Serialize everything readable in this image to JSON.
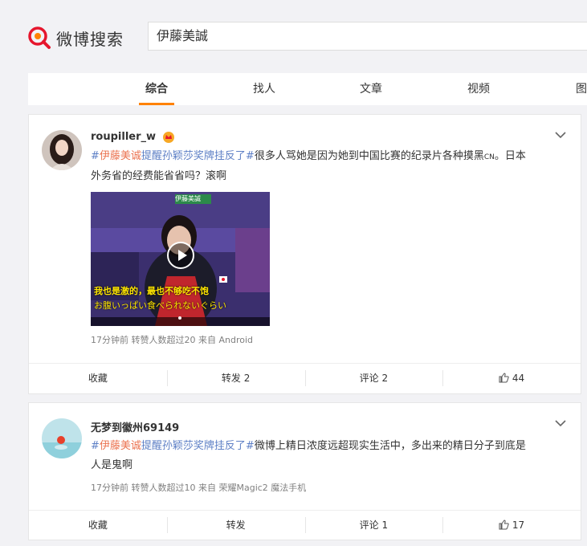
{
  "logo": {
    "text": "微博搜索"
  },
  "search": {
    "value": "伊藤美誠"
  },
  "tabs": [
    "综合",
    "找人",
    "文章",
    "视频",
    "图"
  ],
  "posts": [
    {
      "user": "roupiller_w",
      "hashtag": "#伊藤美诚提醒孙颖莎奖牌挂反了#",
      "hashtag_highlight": "伊藤美诚",
      "hashtag_rest": "提醒孙颖莎奖牌挂反了#",
      "text_line1": "很多人骂她是因为她到中国比赛的纪录片各种摸黑",
      "cn_tag": "CN",
      "text_line1_end": "。日本",
      "text_line2": "外务省的经费能省省吗？滚啊",
      "video_caption1": "我也是激的，最也不够吃不饱",
      "video_caption2": "お腹いっぱい食べられないぐらい",
      "video_tag": "伊藤美誠",
      "meta": "17分钟前  转赞人数超过20  来自 Android",
      "actions": {
        "fav": "收藏",
        "repost": "转发 2",
        "comment": "评论 2",
        "like": "44"
      }
    },
    {
      "user": "无梦到徽州69149",
      "hashtag_highlight": "伊藤美诚",
      "hashtag_rest": "提醒孙颖莎奖牌挂反了#",
      "text_line1": "微博上精日浓度远超现实生活中，多出来的精日分子到底是",
      "text_line2": "人是鬼啊",
      "meta": "17分钟前  转赞人数超过10  来自 荣耀Magic2 魔法手机",
      "actions": {
        "fav": "收藏",
        "repost": "转发",
        "comment": "评论 1",
        "like": "17"
      }
    }
  ]
}
